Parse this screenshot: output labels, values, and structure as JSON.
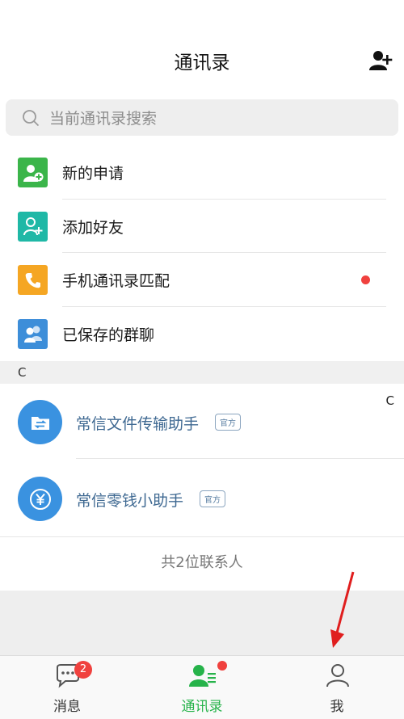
{
  "header": {
    "title": "通讯录"
  },
  "search": {
    "placeholder": "当前通讯录搜索"
  },
  "fixed_items": [
    {
      "label": "新的申请",
      "icon": "new-request-icon",
      "color": "#3bb54a"
    },
    {
      "label": "添加好友",
      "icon": "add-friend-icon",
      "color": "#1fb8a6"
    },
    {
      "label": "手机通讯录匹配",
      "icon": "phone-book-icon",
      "color": "#f5a623",
      "has_unread_dot": true
    },
    {
      "label": "已保存的群聊",
      "icon": "group-chat-icon",
      "color": "#3d8ed9"
    }
  ],
  "section": {
    "letter": "C"
  },
  "index_letter": "C",
  "contacts": [
    {
      "name": "常信文件传输助手",
      "badge": "官方",
      "icon": "file-transfer-icon",
      "color": "#3a92e0"
    },
    {
      "name": "常信零钱小助手",
      "badge": "官方",
      "icon": "yuan-icon",
      "color": "#3a92e0"
    }
  ],
  "total_text": "共2位联系人",
  "tabs": [
    {
      "label": "消息",
      "icon": "chat-bubble-icon",
      "badge": "2"
    },
    {
      "label": "通讯录",
      "icon": "contacts-icon",
      "active": true
    },
    {
      "label": "我",
      "icon": "person-icon"
    }
  ],
  "colors": {
    "accent_green": "#26b34a",
    "badge_red": "#f0413e",
    "link_blue": "#3f6992"
  }
}
